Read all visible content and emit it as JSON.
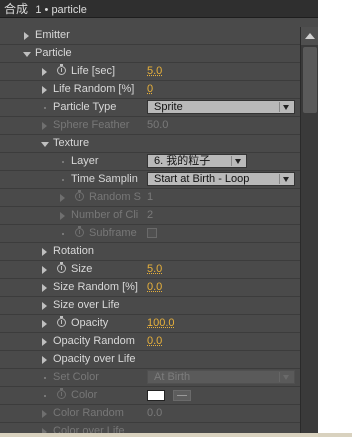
{
  "header": {
    "title": "合成",
    "crumb": "1 • particle"
  },
  "rows": {
    "emitter": {
      "label": "Emitter"
    },
    "particle": {
      "label": "Particle"
    },
    "life": {
      "label": "Life [sec]",
      "value": "5.0"
    },
    "life_random": {
      "label": "Life Random [%]",
      "value": "0"
    },
    "particle_type": {
      "label": "Particle Type",
      "value": "Sprite"
    },
    "sphere_feather": {
      "label": "Sphere Feather",
      "value": "50.0"
    },
    "texture": {
      "label": "Texture"
    },
    "layer": {
      "label": "Layer",
      "value": "6. 我的粒子"
    },
    "time_sampling": {
      "label": "Time Samplin",
      "value": "Start at Birth -  Loop"
    },
    "random_s": {
      "label": "Random S",
      "value": "1"
    },
    "number_of_clips": {
      "label": "Number of Cli",
      "value": "2"
    },
    "subframe": {
      "label": "Subframe"
    },
    "rotation": {
      "label": "Rotation"
    },
    "size": {
      "label": "Size",
      "value": "5.0"
    },
    "size_random": {
      "label": "Size Random [%]",
      "value": "0.0"
    },
    "size_over_life": {
      "label": "Size over Life"
    },
    "opacity": {
      "label": "Opacity",
      "value": "100.0"
    },
    "opacity_random": {
      "label": "Opacity Random",
      "value": "0.0"
    },
    "opacity_over_life": {
      "label": "Opacity over Life"
    },
    "set_color": {
      "label": "Set Color",
      "value": "At Birth"
    },
    "color": {
      "label": "Color",
      "swatch": "#ffffff"
    },
    "color_random": {
      "label": "Color Random",
      "value": "0.0"
    },
    "color_over_life": {
      "label": "Color over Life"
    }
  },
  "colors": {
    "value_accent": "#e8b13b",
    "panel_bg": "#4a4a4a",
    "header_bg": "#2f2f2f"
  }
}
